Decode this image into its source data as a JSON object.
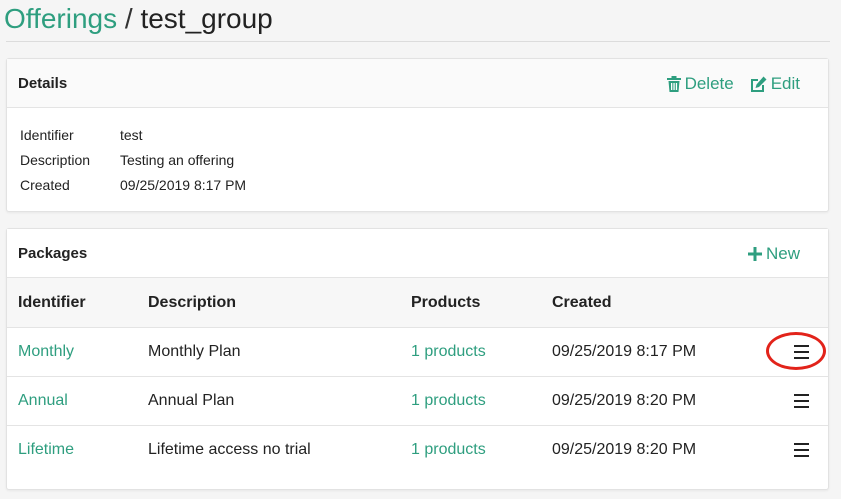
{
  "breadcrumb": {
    "parent": "Offerings",
    "separator": "/",
    "current": "test_group"
  },
  "details": {
    "title": "Details",
    "delete_label": "Delete",
    "edit_label": "Edit",
    "rows": [
      {
        "label": "Identifier",
        "value": "test"
      },
      {
        "label": "Description",
        "value": "Testing an offering"
      },
      {
        "label": "Created",
        "value": "09/25/2019 8:17 PM"
      }
    ]
  },
  "packages": {
    "title": "Packages",
    "new_label": "New",
    "columns": [
      "Identifier",
      "Description",
      "Products",
      "Created"
    ],
    "rows": [
      {
        "identifier": "Monthly",
        "description": "Monthly Plan",
        "products": "1 products",
        "created": "09/25/2019 8:17 PM"
      },
      {
        "identifier": "Annual",
        "description": "Annual Plan",
        "products": "1 products",
        "created": "09/25/2019 8:20 PM"
      },
      {
        "identifier": "Lifetime",
        "description": "Lifetime access no trial",
        "products": "1 products",
        "created": "09/25/2019 8:20 PM"
      }
    ]
  },
  "colors": {
    "accent": "#2e9e7f",
    "highlight": "#e2231a"
  },
  "icons": {
    "delete": "trash-icon",
    "edit": "edit-icon",
    "new": "plus-icon",
    "row_menu": "hamburger-menu-icon"
  }
}
